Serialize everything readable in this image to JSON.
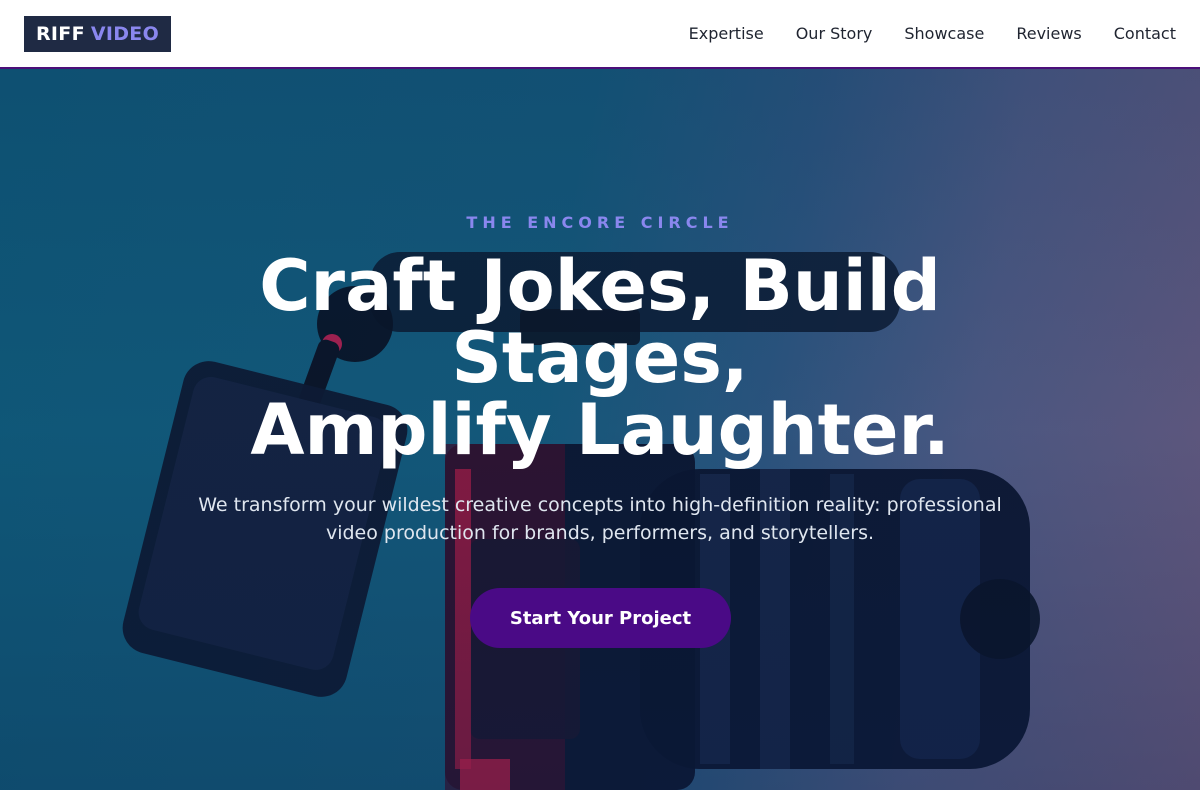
{
  "header": {
    "logo": {
      "word1": "RIFF",
      "word2": "VIDEO"
    },
    "nav": [
      {
        "label": "Expertise"
      },
      {
        "label": "Our Story"
      },
      {
        "label": "Showcase"
      },
      {
        "label": "Reviews"
      },
      {
        "label": "Contact"
      }
    ]
  },
  "hero": {
    "eyebrow": "THE ENCORE CIRCLE",
    "headline_lines": [
      "Craft Jokes, Build",
      "Stages,",
      "Amplify Laughter."
    ],
    "subtext": "We transform your wildest creative concepts into high-definition reality: professional video production for brands, performers, and storytellers.",
    "cta_label": "Start Your Project",
    "background_image": "video-camera-photo"
  },
  "colors": {
    "accent": "#8a87ee",
    "cta": "#4a0a86",
    "header_border": "#4b0f7a",
    "logo_bg": "#1f2a44"
  }
}
